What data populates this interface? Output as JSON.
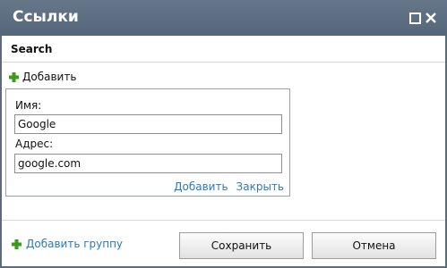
{
  "window": {
    "title": "Ссылки",
    "controls": {
      "maximize_icon": "maximize-icon",
      "close_icon": "close-icon"
    }
  },
  "section": {
    "title": "Search"
  },
  "add_link": {
    "icon": "plus-icon",
    "label": "Добавить",
    "icon_color": "#3c9a1e"
  },
  "link_form": {
    "name_label": "Имя:",
    "name_value": "Google",
    "address_label": "Адрес:",
    "address_value": "google.com",
    "add_action": "Добавить",
    "close_action": "Закрыть"
  },
  "footer": {
    "add_group_label": "Добавить группу",
    "save_label": "Сохранить",
    "cancel_label": "Отмена"
  },
  "colors": {
    "titlebar": "#5b6b7d",
    "link": "#2a7ab8",
    "plus_icon": "#3c9a1e"
  }
}
